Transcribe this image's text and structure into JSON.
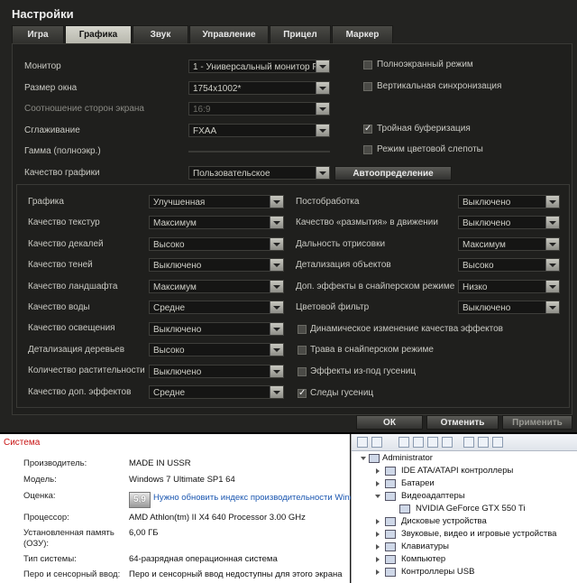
{
  "game": {
    "title": "Настройки",
    "tabs": [
      "Игра",
      "Графика",
      "Звук",
      "Управление",
      "Прицел",
      "Маркер"
    ],
    "active_tab": "Графика",
    "top": {
      "monitor_label": "Монитор",
      "monitor_value": "1 - Универсальный монитор PnI",
      "window_size_label": "Размер окна",
      "window_size_value": "1754x1002*",
      "aspect_label": "Соотношение сторон экрана",
      "aspect_value": "16:9",
      "aa_label": "Сглаживание",
      "aa_value": "FXAA",
      "gamma_label": "Гамма (полноэкр.)",
      "quality_label": "Качество графики",
      "quality_value": "Пользовательское",
      "autodetect_label": "Автоопределение",
      "fullscreen_label": "Полноэкранный режим",
      "fullscreen_checked": false,
      "vsync_label": "Вертикальная синхронизация",
      "vsync_checked": false,
      "triple_label": "Тройная буферизация",
      "triple_checked": true,
      "colorblind_label": "Режим цветовой слепоты",
      "colorblind_checked": false
    },
    "left": [
      {
        "label": "Графика",
        "value": "Улучшенная"
      },
      {
        "label": "Качество текстур",
        "value": "Максимум"
      },
      {
        "label": "Качество декалей",
        "value": "Высоко"
      },
      {
        "label": "Качество теней",
        "value": "Выключено"
      },
      {
        "label": "Качество ландшафта",
        "value": "Максимум"
      },
      {
        "label": "Качество воды",
        "value": "Средне"
      },
      {
        "label": "Качество освещения",
        "value": "Выключено"
      },
      {
        "label": "Детализация деревьев",
        "value": "Высоко"
      },
      {
        "label": "Количество растительности",
        "value": "Выключено"
      },
      {
        "label": "Качество доп. эффектов",
        "value": "Средне"
      }
    ],
    "right": [
      {
        "label": "Постобработка",
        "value": "Выключено"
      },
      {
        "label": "Качество «размытия» в движении",
        "value": "Выключено"
      },
      {
        "label": "Дальность отрисовки",
        "value": "Максимум"
      },
      {
        "label": "Детализация объектов",
        "value": "Высоко"
      },
      {
        "label": "Доп. эффекты в снайперском режиме",
        "value": "Низко"
      },
      {
        "label": "Цветовой фильтр",
        "value": "Выключено"
      }
    ],
    "checks": [
      {
        "label": "Динамическое изменение качества эффектов",
        "checked": false
      },
      {
        "label": "Трава в снайперском режиме",
        "checked": false
      },
      {
        "label": "Эффекты из-под гусениц",
        "checked": false
      },
      {
        "label": "Следы гусениц",
        "checked": true
      }
    ],
    "buttons": {
      "ok": "ОК",
      "cancel": "Отменить",
      "apply": "Применить"
    }
  },
  "system": {
    "title": "Система",
    "manufacturer_label": "Производитель:",
    "manufacturer_value": "MADE IN USSR",
    "model_label": "Модель:",
    "model_value": "Windows 7 Ultimate SP1 64",
    "rating_label": "Оценка:",
    "rating_score": "5,9",
    "rating_link": "Нужно обновить индекс производительности Wind",
    "cpu_label": "Процессор:",
    "cpu_value": "AMD Athlon(tm) II X4 640 Processor   3.00 GHz",
    "ram_label_1": "Установленная память",
    "ram_label_2": "(ОЗУ):",
    "ram_value": "6,00 ГБ",
    "type_label": "Тип системы:",
    "type_value": "64-разрядная операционная система",
    "pen_label": "Перо и сенсорный ввод:",
    "pen_value": "Перо и сенсорный ввод недоступны для этого экрана"
  },
  "devices": {
    "root": "Administrator",
    "items": [
      "IDE ATA/ATAPI контроллеры",
      "Батареи",
      "Видеоадаптеры",
      "NVIDIA GeForce GTX 550 Ti",
      "Дисковые устройства",
      "Звуковые, видео и игровые устройства",
      "Клавиатуры",
      "Компьютер",
      "Контроллеры USB"
    ]
  }
}
